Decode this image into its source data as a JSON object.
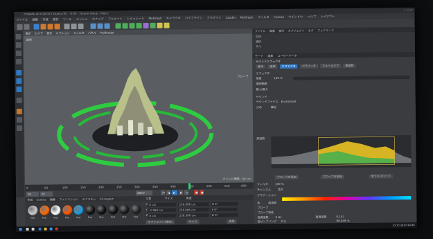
{
  "window": {
    "title": "CINEMA 4D R19.053 Studio (RC - R19) - [Scene Setup - Main]"
  },
  "menu": [
    "ファイル",
    "編集",
    "作成",
    "選択",
    "ツール",
    "メッシュ",
    "スナップ",
    "アニメート",
    "シミュレート",
    "MoGraph",
    "キャラクタ",
    "パイプライン",
    "プラグイン",
    "Lauder",
    "MoGraph",
    "フィルタ",
    "Corona",
    "ウインドウ",
    "ヘルプ",
    "レイアウト"
  ],
  "viewport": {
    "menu": [
      "表示",
      "カメラ",
      "表示",
      "オプション",
      "フィルタ",
      "パネル",
      "ProRender"
    ],
    "label": "透視",
    "right_label": "フローラ",
    "grid_spacing": "グリッド間隔：50 cm"
  },
  "timeline": {
    "ticks": [
      "0",
      "50",
      "100",
      "150",
      "200",
      "250",
      "300",
      "350",
      "400",
      "450",
      "500",
      "550",
      "600"
    ],
    "frame_label": "0F"
  },
  "transport": {
    "start": "0F",
    "end": "600 F"
  },
  "materials": {
    "tabs": [
      "作成",
      "Corona",
      "編集",
      "ファンクション",
      "テクスチャ",
      "CV-Import"
    ],
    "items": [
      {
        "name": "Mat",
        "color": "#c9c9c9"
      },
      {
        "name": "Mat",
        "color": "#ff6a00"
      },
      {
        "name": "Mat",
        "color": "#ffffff"
      },
      {
        "name": "Mat",
        "color": "#ff5500"
      },
      {
        "name": "Mat",
        "color": "#1e9de0"
      },
      {
        "name": "Mat",
        "color": "#111111"
      },
      {
        "name": "Mat",
        "color": "#111111"
      },
      {
        "name": "Mat",
        "color": "#111111"
      },
      {
        "name": "Mat",
        "color": "#1a1a1a"
      },
      {
        "name": "Mat",
        "color": "#222222"
      }
    ]
  },
  "coordinates": {
    "headers": [
      "位置",
      "サイズ",
      "角度"
    ],
    "rows": [
      {
        "axis": "X",
        "pos": "0 cm",
        "size": "258.086 cm",
        "rot": "H 0°"
      },
      {
        "axis": "Y",
        "pos": "-2.968 cm",
        "size": "258.086 cm",
        "rot": "P 0°"
      },
      {
        "axis": "Z",
        "pos": "0 cm",
        "size": "258.086 cm",
        "rot": "B 0°"
      }
    ],
    "mode": "オブジェクト(相対)",
    "size_mode": "サイズ",
    "apply": "適用"
  },
  "object_manager": {
    "menu": [
      "ファイル",
      "編集",
      "表示",
      "オブジェクト",
      "タグ",
      "ブックマーク"
    ],
    "rows": [
      "立体",
      "波紋",
      "ヌル"
    ]
  },
  "attributes": {
    "menu": [
      "モード",
      "編集",
      "ユーザーデータ"
    ],
    "title": "サウンドエフェクタ",
    "tabs": [
      "基本",
      "座標",
      "エフェクタ",
      "パラメータ",
      "フォールオフ",
      "周波数"
    ],
    "active_tab": 2,
    "effector_label": "エフェクタ",
    "strength_label": "強度",
    "strength_value": "100 %",
    "selection_label": "選択範囲",
    "minmax_label": "最小/最大",
    "sound_label": "サウンド",
    "sound_file_label": "サウンドファイル",
    "sound_file_value": "Enchanted",
    "distribution_label": "分布",
    "distribution_value": "繰返",
    "graph_label": "周波数",
    "buttons": [
      "プローブを追加",
      "プローブを削除",
      "全てのプローブ"
    ],
    "filter_label": "フィルタ",
    "filter_value": "100 %",
    "channel_label": "チャンネル",
    "channel_value": "両方",
    "gradient_label": "グラデーション",
    "color_label": "色",
    "color_value": "周波数",
    "probe_label": "プローブ",
    "probe_section": "プローブ特性",
    "freq_low_label": "低周波数",
    "freq_low_value": "0 Hz",
    "freq_high_label": "高周波数",
    "freq_high_value": "0.157",
    "sample_label": "低サンプリング",
    "sample_value": "0 %",
    "sample_high_value": "90.039 %",
    "sampling_label": "サンプリング",
    "sampling_value": "ピーク",
    "decay_label": "ディケイ",
    "decay_value": "0 %",
    "strength2_label": "強度",
    "strength2_value": "100 %"
  },
  "taskbar": {
    "time": "13:15",
    "date": "2017/10/16"
  }
}
